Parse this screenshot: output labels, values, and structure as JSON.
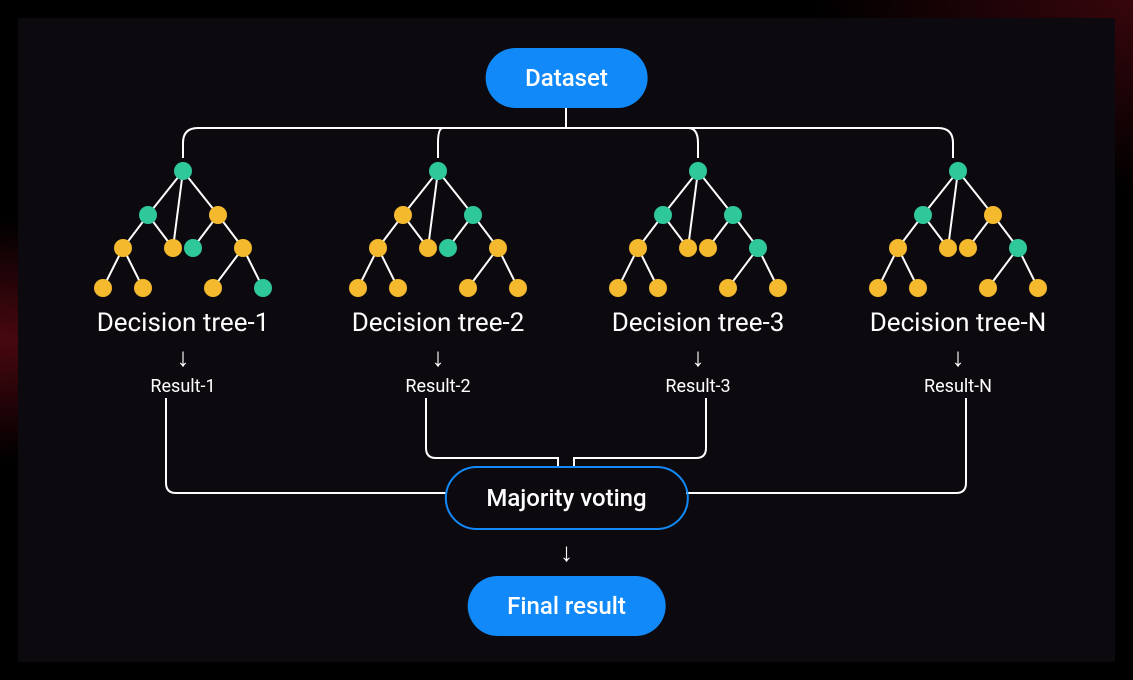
{
  "title": "Dataset",
  "trees": [
    {
      "label": "Decision tree-1",
      "result": "Result-1"
    },
    {
      "label": "Decision tree-2",
      "result": "Result-2"
    },
    {
      "label": "Decision tree-3",
      "result": "Result-3"
    },
    {
      "label": "Decision tree-N",
      "result": "Result-N"
    }
  ],
  "aggregator": "Majority voting",
  "final": "Final result",
  "colors": {
    "accent": "#1289f8",
    "nodeA": "#2fc89a",
    "nodeB": "#f5b92e",
    "line": "#ffffff"
  },
  "treeColorings": [
    [
      "A",
      "A",
      "B",
      "B",
      "B",
      "A",
      "B",
      "B",
      "B",
      "B",
      "A"
    ],
    [
      "A",
      "B",
      "A",
      "B",
      "B",
      "A",
      "B",
      "B",
      "B",
      "B",
      "B"
    ],
    [
      "A",
      "A",
      "A",
      "B",
      "B",
      "B",
      "A",
      "B",
      "B",
      "B",
      "B"
    ],
    [
      "A",
      "A",
      "B",
      "B",
      "B",
      "B",
      "A",
      "B",
      "B",
      "B",
      "B"
    ]
  ]
}
